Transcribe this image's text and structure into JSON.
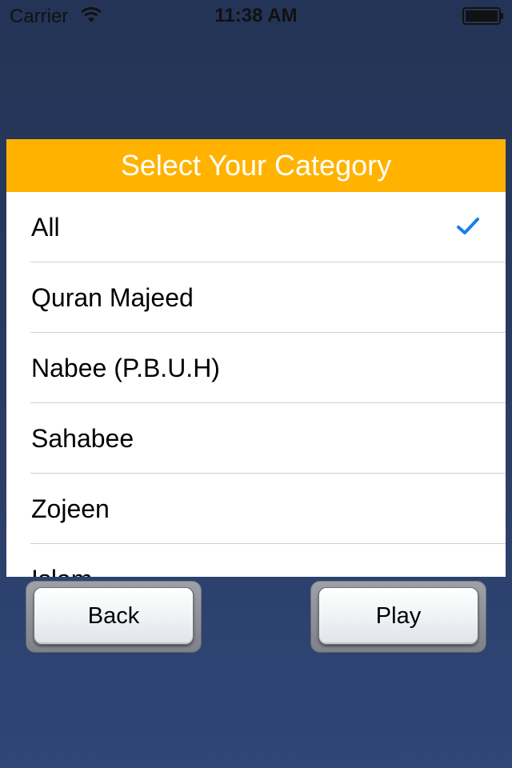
{
  "status_bar": {
    "carrier": "Carrier",
    "time": "11:38 AM",
    "wifi_icon": "wifi-icon",
    "battery_icon": "battery-icon"
  },
  "dialog": {
    "title": "Select Your Category",
    "header_color": "#ffb300",
    "items": [
      {
        "label": "All",
        "selected": true
      },
      {
        "label": "Quran Majeed",
        "selected": false
      },
      {
        "label": "Nabee (P.B.U.H)",
        "selected": false
      },
      {
        "label": "Sahabee",
        "selected": false
      },
      {
        "label": "Zojeen",
        "selected": false
      },
      {
        "label": "Islam",
        "selected": false
      }
    ],
    "check_icon": "checkmark-icon",
    "check_color": "#1a7ee6"
  },
  "buttons": {
    "back_label": "Back",
    "play_label": "Play"
  }
}
